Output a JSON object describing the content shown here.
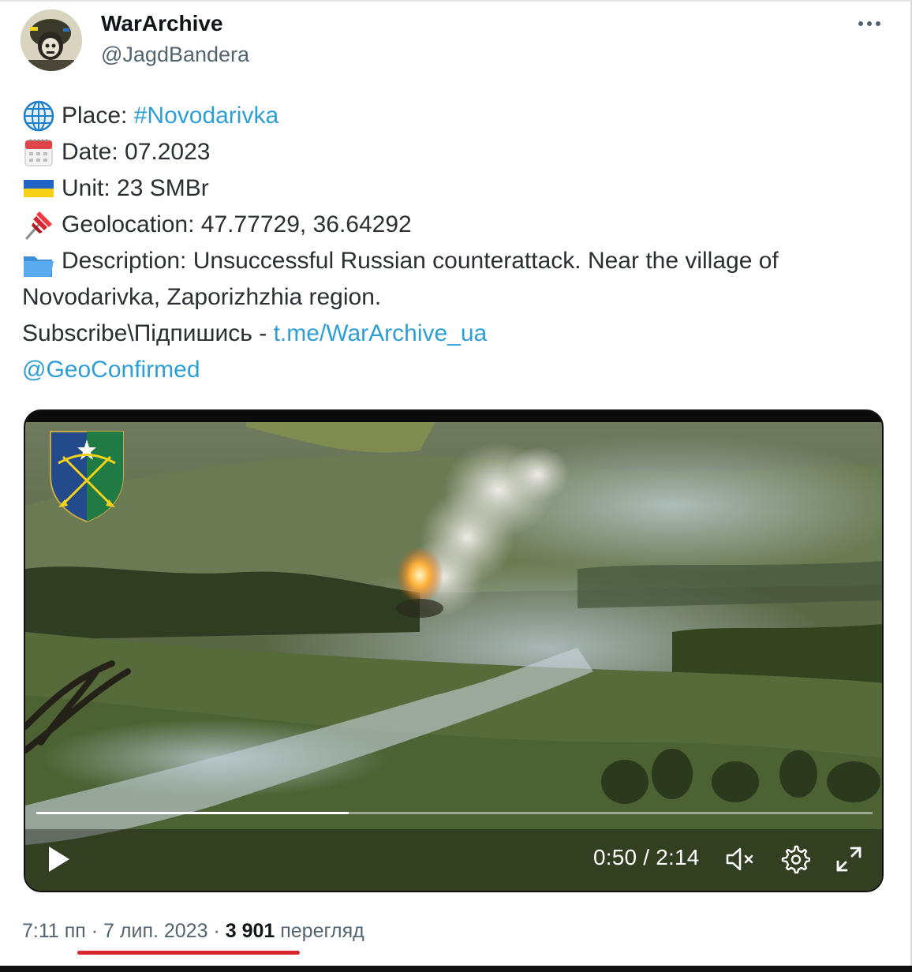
{
  "author": {
    "name": "WarArchive",
    "handle": "@JagdBandera",
    "avatar_icon": "soldier-avatar"
  },
  "more_icon": "more-horizontal-icon",
  "body": {
    "place": {
      "emoji": "globe-icon",
      "label": "Place: ",
      "hashtag": "#Novodarivka"
    },
    "date": {
      "emoji": "calendar-icon",
      "text": "Date: 07.2023"
    },
    "unit": {
      "emoji": "ukraine-flag-icon",
      "text": "Unit: 23 SMBr"
    },
    "geolocation": {
      "emoji": "pushpin-icon",
      "text": "Geolocation: 47.77729, 36.64292"
    },
    "description": {
      "emoji": "folder-icon",
      "text": "Description: Unsuccessful Russian counterattack. Near the village of Novodarivka, Zaporizhzhia region."
    },
    "subscribe": {
      "label": "Subscribe\\Підпишись - ",
      "link": "t.me/WarArchive_ua"
    },
    "mention": "@GeoConfirmed"
  },
  "video": {
    "time": "0:50 / 2:14",
    "progress": 0.374,
    "emblem_icon": "brigade-emblem",
    "play_icon": "play-icon",
    "mute_icon": "volume-muted-icon",
    "settings_icon": "settings-gear-icon",
    "fullscreen_icon": "fullscreen-icon"
  },
  "meta": {
    "time": "7:11 пп",
    "sep1": " · ",
    "date": "7 лип. 2023",
    "sep2": " · ",
    "views": "3 901",
    "views_label": " перегляд"
  },
  "colors": {
    "link": "#2e9fd6",
    "text": "#2b2f33",
    "muted": "#536471",
    "underline": "#d8262c"
  }
}
